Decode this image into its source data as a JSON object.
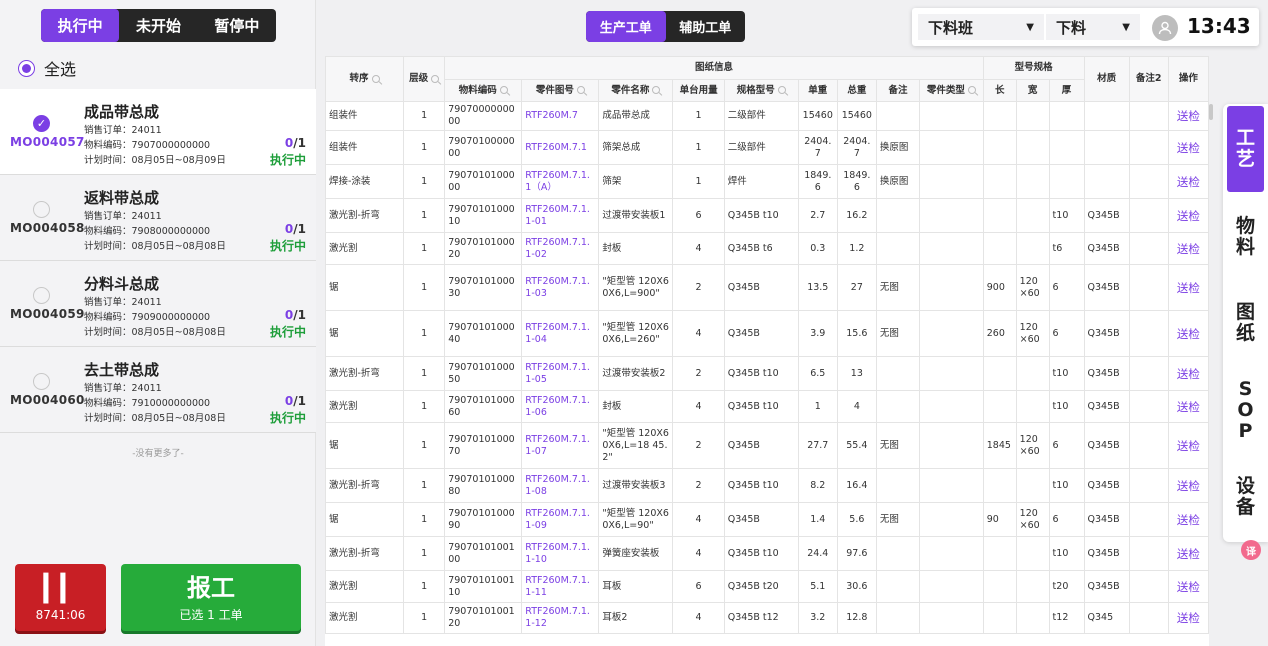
{
  "status_tabs": [
    "执行中",
    "未开始",
    "暂停中"
  ],
  "select_all_label": "全选",
  "orders": [
    {
      "code": "MO004057",
      "name": "成品带总成",
      "sales_order": "销售订单：24011",
      "material": "物料编码：7907000000000",
      "plan": "计划时间：08月05日~08月09日",
      "done": "0",
      "total": "/1",
      "status": "执行中",
      "selected": true
    },
    {
      "code": "MO004058",
      "name": "返料带总成",
      "sales_order": "销售订单：24011",
      "material": "物料编码：7908000000000",
      "plan": "计划时间：08月05日~08月08日",
      "done": "0",
      "total": "/1",
      "status": "执行中",
      "selected": false
    },
    {
      "code": "MO004059",
      "name": "分料斗总成",
      "sales_order": "销售订单：24011",
      "material": "物料编码：7909000000000",
      "plan": "计划时间：08月05日~08月08日",
      "done": "0",
      "total": "/1",
      "status": "执行中",
      "selected": false
    },
    {
      "code": "MO004060",
      "name": "去土带总成",
      "sales_order": "销售订单：24011",
      "material": "物料编码：7910000000000",
      "plan": "计划时间：08月05日~08月08日",
      "done": "0",
      "total": "/1",
      "status": "执行中",
      "selected": false
    }
  ],
  "no_more": "-没有更多了-",
  "pause": {
    "icon": "pause-icon",
    "timer": "8741:06"
  },
  "report": {
    "label": "报工",
    "sub": "已选 1 工单"
  },
  "main_tabs": [
    "生产工单",
    "辅助工单"
  ],
  "shift": "下料班",
  "process": "下料",
  "clock": "13:43",
  "table": {
    "group_headers": {
      "drawing": "图纸信息",
      "spec": "型号规格"
    },
    "headers": {
      "seq": "转序",
      "level": "层级",
      "material_code": "物料编码",
      "part_drawing": "零件图号",
      "part_name": "零件名称",
      "unit_qty": "单台用量",
      "spec_model": "规格型号",
      "unit_weight": "单重",
      "total_weight": "总重",
      "remark": "备注",
      "part_type": "零件类型",
      "len": "长",
      "width": "宽",
      "thick": "厚",
      "material": "材质",
      "remark2": "备注2",
      "op": "操作"
    },
    "rows": [
      [
        "组装件",
        "1",
        "7907000000000",
        "RTF260M.7",
        "成品带总成",
        "1",
        "二级部件",
        "15460",
        "15460",
        "",
        "",
        "",
        "",
        "",
        "",
        "",
        "送检"
      ],
      [
        "组装件",
        "1",
        "7907010000000",
        "RTF260M.7.1",
        "筛架总成",
        "1",
        "二级部件",
        "2404.7",
        "2404.7",
        "换原图",
        "",
        "",
        "",
        "",
        "",
        "",
        "送检"
      ],
      [
        "焊接-涂装",
        "1",
        "7907010100000",
        "RTF260M.7.1.1（A）",
        "筛架",
        "1",
        "焊件",
        "1849.6",
        "1849.6",
        "换原图",
        "",
        "",
        "",
        "",
        "",
        "",
        "送检"
      ],
      [
        "激光割-折弯",
        "1",
        "7907010100010",
        "RTF260M.7.1.1-01",
        "过渡带安装板1",
        "6",
        "Q345B t10",
        "2.7",
        "16.2",
        "",
        "",
        "",
        "",
        "t10",
        "Q345B",
        "",
        "送检"
      ],
      [
        "激光割",
        "1",
        "7907010100020",
        "RTF260M.7.1.1-02",
        "封板",
        "4",
        "Q345B t6",
        "0.3",
        "1.2",
        "",
        "",
        "",
        "",
        "t6",
        "Q345B",
        "",
        "送检"
      ],
      [
        "锯",
        "1",
        "7907010100030",
        "RTF260M.7.1.1-03",
        "\"矩型管 120X60X6,L=900\"",
        "2",
        "Q345B",
        "13.5",
        "27",
        "无图",
        "",
        "900",
        "120×60",
        "6",
        "Q345B",
        "",
        "送检"
      ],
      [
        "锯",
        "1",
        "7907010100040",
        "RTF260M.7.1.1-04",
        "\"矩型管 120X60X6,L=260\"",
        "4",
        "Q345B",
        "3.9",
        "15.6",
        "无图",
        "",
        "260",
        "120×60",
        "6",
        "Q345B",
        "",
        "送检"
      ],
      [
        "激光割-折弯",
        "1",
        "7907010100050",
        "RTF260M.7.1.1-05",
        "过渡带安装板2",
        "2",
        "Q345B t10",
        "6.5",
        "13",
        "",
        "",
        "",
        "",
        "t10",
        "Q345B",
        "",
        "送检"
      ],
      [
        "激光割",
        "1",
        "7907010100060",
        "RTF260M.7.1.1-06",
        "封板",
        "4",
        "Q345B t10",
        "1",
        "4",
        "",
        "",
        "",
        "",
        "t10",
        "Q345B",
        "",
        "送检"
      ],
      [
        "锯",
        "1",
        "7907010100070",
        "RTF260M.7.1.1-07",
        "\"矩型管 120X60X6,L=18 45.2\"",
        "2",
        "Q345B",
        "27.7",
        "55.4",
        "无图",
        "",
        "1845",
        "120×60",
        "6",
        "Q345B",
        "",
        "送检"
      ],
      [
        "激光割-折弯",
        "1",
        "7907010100080",
        "RTF260M.7.1.1-08",
        "过渡带安装板3",
        "2",
        "Q345B t10",
        "8.2",
        "16.4",
        "",
        "",
        "",
        "",
        "t10",
        "Q345B",
        "",
        "送检"
      ],
      [
        "锯",
        "1",
        "7907010100090",
        "RTF260M.7.1.1-09",
        "\"矩型管 120X60X6,L=90\"",
        "4",
        "Q345B",
        "1.4",
        "5.6",
        "无图",
        "",
        "90",
        "120×60",
        "6",
        "Q345B",
        "",
        "送检"
      ],
      [
        "激光割-折弯",
        "1",
        "7907010100100",
        "RTF260M.7.1.1-10",
        "弹簧座安装板",
        "4",
        "Q345B t10",
        "24.4",
        "97.6",
        "",
        "",
        "",
        "",
        "t10",
        "Q345B",
        "",
        "送检"
      ],
      [
        "激光割",
        "1",
        "7907010100110",
        "RTF260M.7.1.1-11",
        "耳板",
        "6",
        "Q345B t20",
        "5.1",
        "30.6",
        "",
        "",
        "",
        "",
        "t20",
        "Q345B",
        "",
        "送检"
      ],
      [
        "激光割",
        "1",
        "7907010100120",
        "RTF260M.7.1.1-12",
        "耳板2",
        "4",
        "Q345B t12",
        "3.2",
        "12.8",
        "",
        "",
        "",
        "",
        "t12",
        "Q345",
        "",
        "送检"
      ]
    ]
  },
  "right_nav": [
    "工艺",
    "物料",
    "图纸",
    "SOP",
    "设备"
  ],
  "translate_label": "译",
  "colors": {
    "accent": "#7b3fe4",
    "green": "#26ab3a",
    "red": "#c81f25",
    "dark": "#262626"
  }
}
